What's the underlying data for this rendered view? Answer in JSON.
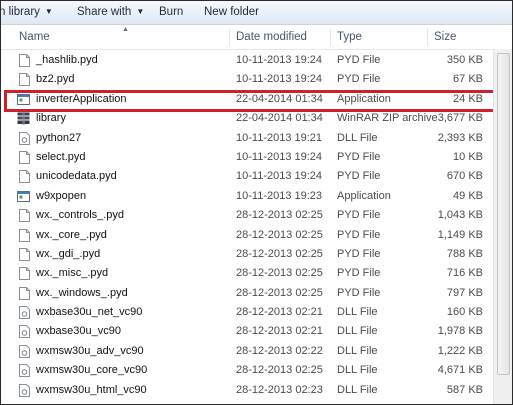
{
  "toolbar": {
    "include_label": "n library",
    "share_label": "Share with",
    "burn_label": "Burn",
    "new_folder_label": "New folder"
  },
  "columns": {
    "name": "Name",
    "date": "Date modified",
    "type": "Type",
    "size": "Size"
  },
  "files": [
    {
      "name": "_hashlib.pyd",
      "date": "10-11-2013 19:24",
      "type": "PYD File",
      "size": "350 KB",
      "icon": "file-icon"
    },
    {
      "name": "bz2.pyd",
      "date": "10-11-2013 19:24",
      "type": "PYD File",
      "size": "67 KB",
      "icon": "file-icon"
    },
    {
      "name": "inverterApplication",
      "date": "22-04-2014 01:34",
      "type": "Application",
      "size": "24 KB",
      "icon": "application-icon"
    },
    {
      "name": "library",
      "date": "22-04-2014 01:34",
      "type": "WinRAR ZIP archive",
      "size": "3,677 KB",
      "icon": "zip-archive-icon"
    },
    {
      "name": "python27",
      "date": "10-11-2013 19:21",
      "type": "DLL File",
      "size": "2,393 KB",
      "icon": "dll-icon"
    },
    {
      "name": "select.pyd",
      "date": "10-11-2013 19:24",
      "type": "PYD File",
      "size": "10 KB",
      "icon": "file-icon"
    },
    {
      "name": "unicodedata.pyd",
      "date": "10-11-2013 19:24",
      "type": "PYD File",
      "size": "670 KB",
      "icon": "file-icon"
    },
    {
      "name": "w9xpopen",
      "date": "10-11-2013 19:23",
      "type": "Application",
      "size": "49 KB",
      "icon": "application-icon"
    },
    {
      "name": "wx._controls_.pyd",
      "date": "28-12-2013 02:25",
      "type": "PYD File",
      "size": "1,043 KB",
      "icon": "file-icon"
    },
    {
      "name": "wx._core_.pyd",
      "date": "28-12-2013 02:25",
      "type": "PYD File",
      "size": "1,149 KB",
      "icon": "file-icon"
    },
    {
      "name": "wx._gdi_.pyd",
      "date": "28-12-2013 02:25",
      "type": "PYD File",
      "size": "788 KB",
      "icon": "file-icon"
    },
    {
      "name": "wx._misc_.pyd",
      "date": "28-12-2013 02:25",
      "type": "PYD File",
      "size": "716 KB",
      "icon": "file-icon"
    },
    {
      "name": "wx._windows_.pyd",
      "date": "28-12-2013 02:25",
      "type": "PYD File",
      "size": "797 KB",
      "icon": "file-icon"
    },
    {
      "name": "wxbase30u_net_vc90",
      "date": "28-12-2013 02:21",
      "type": "DLL File",
      "size": "160 KB",
      "icon": "dll-icon"
    },
    {
      "name": "wxbase30u_vc90",
      "date": "28-12-2013 02:21",
      "type": "DLL File",
      "size": "1,978 KB",
      "icon": "dll-icon"
    },
    {
      "name": "wxmsw30u_adv_vc90",
      "date": "28-12-2013 02:22",
      "type": "DLL File",
      "size": "1,222 KB",
      "icon": "dll-icon"
    },
    {
      "name": "wxmsw30u_core_vc90",
      "date": "28-12-2013 02:25",
      "type": "DLL File",
      "size": "4,671 KB",
      "icon": "dll-icon"
    },
    {
      "name": "wxmsw30u_html_vc90",
      "date": "28-12-2013 02:23",
      "type": "DLL File",
      "size": "587 KB",
      "icon": "dll-icon"
    }
  ],
  "highlight_color": "#d0202b"
}
